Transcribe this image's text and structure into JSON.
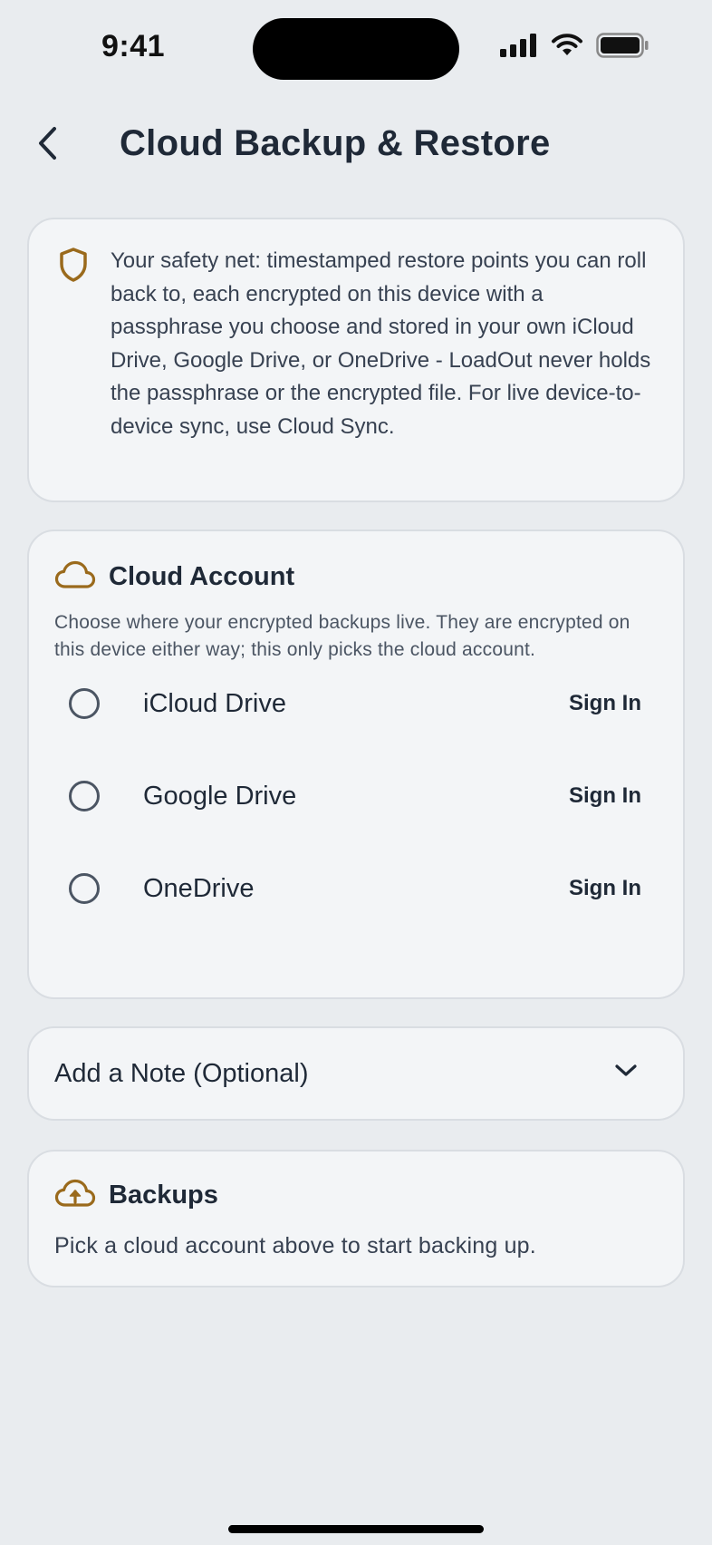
{
  "status_bar": {
    "time": "9:41"
  },
  "nav": {
    "title": "Cloud Backup & Restore"
  },
  "intro": {
    "text": "Your safety net: timestamped restore points you can roll back to, each encrypted on this device with a passphrase you choose and stored in your own iCloud Drive, Google Drive, or OneDrive - LoadOut never holds the passphrase or the encrypted file. For live device-to-device sync, use Cloud Sync."
  },
  "cloud_account": {
    "title": "Cloud Account",
    "description": "Choose where your encrypted backups live. They are encrypted on this device either way; this only picks the cloud account.",
    "providers": [
      {
        "name": "iCloud Drive",
        "action": "Sign In",
        "selected": false
      },
      {
        "name": "Google Drive",
        "action": "Sign In",
        "selected": false
      },
      {
        "name": "OneDrive",
        "action": "Sign In",
        "selected": false
      }
    ]
  },
  "note": {
    "label": "Add a Note (Optional)"
  },
  "backups": {
    "title": "Backups",
    "empty_text": "Pick a cloud account above to start backing up."
  },
  "colors": {
    "accent": "#9a6a1c",
    "background": "#e9ecef",
    "card": "#f3f5f7",
    "text": "#1f2937"
  },
  "icons": [
    "back-chevron-icon",
    "shield-icon",
    "cloud-icon",
    "chevron-down-icon",
    "cloud-upload-icon"
  ]
}
